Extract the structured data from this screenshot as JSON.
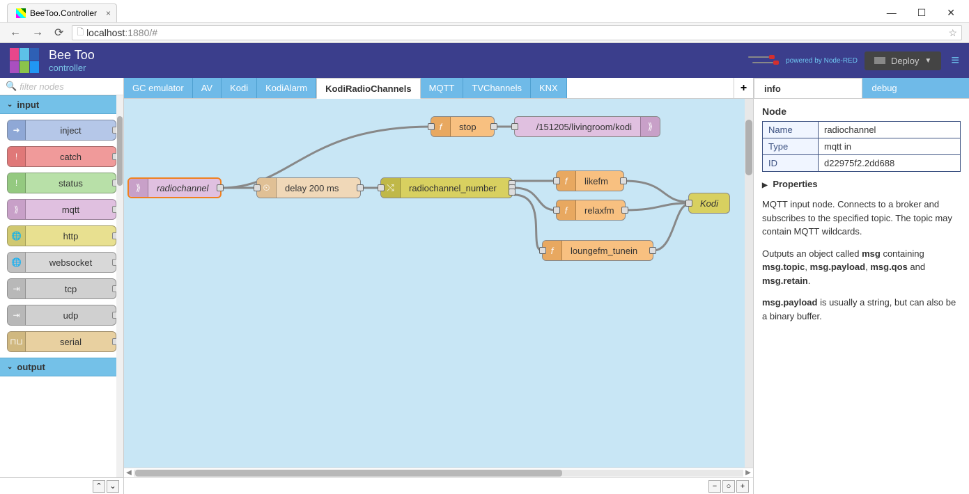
{
  "window": {
    "title": "BeeToo.Controller"
  },
  "browser": {
    "url_host": "localhost",
    "url_port": ":1880",
    "url_hash": "/#"
  },
  "header": {
    "brand_top": "Bee Too",
    "brand_sub": "controller",
    "powered": "powered by Node-RED",
    "deploy": "Deploy"
  },
  "palette": {
    "filter_placeholder": "filter nodes",
    "categories": [
      {
        "name": "input",
        "open": true
      },
      {
        "name": "output",
        "open": true
      }
    ],
    "input_nodes": [
      "inject",
      "catch",
      "status",
      "mqtt",
      "http",
      "websocket",
      "tcp",
      "udp",
      "serial"
    ]
  },
  "workspace": {
    "tabs": [
      "GC emulator",
      "AV",
      "Kodi",
      "KodiAlarm",
      "KodiRadioChannels",
      "MQTT",
      "TVChannels",
      "KNX"
    ],
    "active_tab": "KodiRadioChannels"
  },
  "canvas_nodes": {
    "radiochannel": "radiochannel",
    "delay": "delay 200 ms",
    "switch": "radiochannel_number",
    "stop": "stop",
    "likefm": "likefm",
    "relaxfm": "relaxfm",
    "loungefm": "loungefm_tunein",
    "mqtt_out": "/151205/livingroom/kodi",
    "kodi": "Kodi"
  },
  "sidebar": {
    "tabs": [
      "info",
      "debug"
    ],
    "active_tab": "info",
    "heading": "Node",
    "name_label": "Name",
    "name_value": "radiochannel",
    "type_label": "Type",
    "type_value": "mqtt in",
    "id_label": "ID",
    "id_value": "d22975f2.2dd688",
    "properties": "Properties",
    "desc1": "MQTT input node. Connects to a broker and subscribes to the specified topic. The topic may contain MQTT wildcards.",
    "desc2_a": "Outputs an object called ",
    "desc2_b": "msg",
    "desc2_c": " containing ",
    "desc2_d": "msg.topic",
    "desc2_e": ", ",
    "desc2_f": "msg.payload",
    "desc2_g": ", ",
    "desc2_h": "msg.qos",
    "desc2_i": " and ",
    "desc2_j": "msg.retain",
    "desc2_k": ".",
    "desc3_a": "msg.payload",
    "desc3_b": " is usually a string, but can also be a binary buffer."
  }
}
